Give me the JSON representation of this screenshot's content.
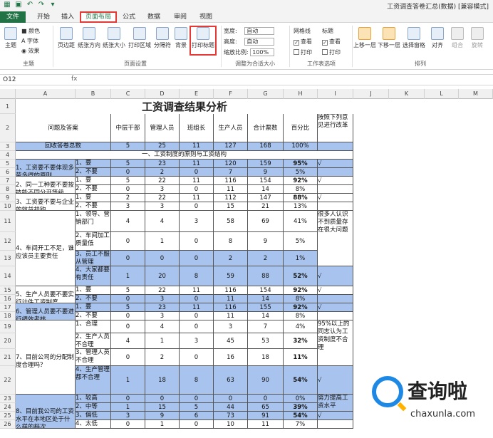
{
  "window": {
    "title": "工资调查答卷汇总(数据) [兼容模式]"
  },
  "tabs": [
    "文件",
    "开始",
    "插入",
    "页面布局",
    "公式",
    "数据",
    "审阅",
    "视图"
  ],
  "ribbon": {
    "theme": {
      "themes": "主题",
      "colors": "颜色",
      "fonts": "字体",
      "effects": "效果",
      "group": "主题"
    },
    "page_setup": {
      "margins": "页边距",
      "orientation": "纸张方向",
      "size": "纸张大小",
      "print_area": "打印区域",
      "breaks": "分隔符",
      "background": "背景",
      "print_titles": "打印标题",
      "group": "页面设置"
    },
    "scale": {
      "width_label": "宽度:",
      "width_value": "自动",
      "height_label": "高度:",
      "height_value": "自动",
      "scale_label": "缩放比例:",
      "scale_value": "100%",
      "group": "调整为合适大小"
    },
    "sheet_options": {
      "gridlines": "网格线",
      "headings": "标题",
      "view": "查看",
      "print": "打印",
      "group": "工作表选项"
    },
    "arrange": {
      "bring_forward": "上移一层",
      "send_backward": "下移一层",
      "selection_pane": "选择窗格",
      "align": "对齐",
      "group_btn": "组合",
      "rotate": "旋转",
      "group": "排列"
    }
  },
  "formula_bar": {
    "name_box": "O12",
    "fx": "fx"
  },
  "columns": [
    "A",
    "B",
    "C",
    "D",
    "E",
    "F",
    "G",
    "H",
    "I",
    "J",
    "K",
    "L",
    "M"
  ],
  "rows": [
    "1",
    "2",
    "3",
    "4",
    "5",
    "6",
    "7",
    "8",
    "9",
    "10",
    "11",
    "12",
    "13",
    "14",
    "15",
    "16",
    "17",
    "18",
    "19",
    "20",
    "21",
    "22",
    "23",
    "24",
    "25",
    "26"
  ],
  "sheet": {
    "title": "工资调查结果分析",
    "header": {
      "q": "问题及答案",
      "c": "中层干部",
      "d": "管理人员",
      "e": "班组长",
      "f": "生产人员",
      "g": "合计票数",
      "h": "百分比",
      "i": "按照下列意见进行改革"
    },
    "total": {
      "label": "回收答卷总数",
      "c": "5",
      "d": "25",
      "e": "11",
      "f": "127",
      "g": "168",
      "h": "100%"
    },
    "section1": "一、工资制度的原则与工资结构",
    "q1": "1、工资要不要体现多劳多得的原则",
    "q2": "2、同一工种要不要按技能不同分开等级",
    "q3": "3、工资要不要与企业的效益挂钩",
    "q4": "4、车间开工不足，谁应该员主要责任",
    "q5": "5、生产人员要不要实行计件工资制度",
    "q6": "6、管理人员要不要进行绩效考核",
    "q7": "7、目前公司的分配制度合理吗？",
    "q8": "8、目前我公司的工资水平在本地区处于什么样的档次",
    "r5": {
      "b": "1、要",
      "c": "5",
      "d": "23",
      "e": "11",
      "f": "120",
      "g": "159",
      "h": "95%",
      "i": "√"
    },
    "r6": {
      "b": "2、不要",
      "c": "0",
      "d": "2",
      "e": "0",
      "f": "7",
      "g": "9",
      "h": "5%"
    },
    "r7": {
      "b": "1、要",
      "c": "5",
      "d": "22",
      "e": "11",
      "f": "116",
      "g": "154",
      "h": "92%",
      "i": "√"
    },
    "r8": {
      "b": "2、不要",
      "c": "0",
      "d": "3",
      "e": "0",
      "f": "11",
      "g": "14",
      "h": "8%"
    },
    "r9": {
      "b": "1、要",
      "c": "2",
      "d": "22",
      "e": "11",
      "f": "112",
      "g": "147",
      "h": "88%",
      "i": "√"
    },
    "r10": {
      "b": "2、不要",
      "c": "3",
      "d": "3",
      "e": "0",
      "f": "15",
      "g": "21",
      "h": "13%"
    },
    "r11": {
      "b": "1、领导、营销部门",
      "c": "4",
      "d": "4",
      "e": "3",
      "f": "58",
      "g": "69",
      "h": "41%",
      "i": "很多人认识不到质量存在很大问题"
    },
    "r12": {
      "b": "2、车间加工质量低",
      "c": "0",
      "d": "1",
      "e": "0",
      "f": "8",
      "g": "9",
      "h": "5%"
    },
    "r13": {
      "b": "3、员工不服从管理",
      "c": "0",
      "d": "0",
      "e": "0",
      "f": "2",
      "g": "2",
      "h": "1%"
    },
    "r14": {
      "b": "4、大家都要有责任",
      "c": "1",
      "d": "20",
      "e": "8",
      "f": "59",
      "g": "88",
      "h": "52%",
      "i": "√"
    },
    "r15": {
      "b": "1、要",
      "c": "5",
      "d": "22",
      "e": "11",
      "f": "116",
      "g": "154",
      "h": "92%",
      "i": "√"
    },
    "r16": {
      "b": "2、不要",
      "c": "0",
      "d": "3",
      "e": "0",
      "f": "11",
      "g": "14",
      "h": "8%"
    },
    "r17": {
      "b": "1、要",
      "c": "5",
      "d": "23",
      "e": "11",
      "f": "116",
      "g": "155",
      "h": "92%",
      "i": "√"
    },
    "r18": {
      "b": "2、不要",
      "c": "0",
      "d": "3",
      "e": "0",
      "f": "11",
      "g": "14",
      "h": "8%"
    },
    "r19": {
      "b": "1、合理",
      "c": "0",
      "d": "4",
      "e": "0",
      "f": "3",
      "g": "7",
      "h": "4%",
      "i": "95%以上的同志认为工资制度不合理"
    },
    "r20": {
      "b": "2、生产人员不合理",
      "c": "4",
      "d": "1",
      "e": "3",
      "f": "45",
      "g": "53",
      "h": "32%"
    },
    "r21": {
      "b": "3、管理人员不合理",
      "c": "0",
      "d": "2",
      "e": "0",
      "f": "16",
      "g": "18",
      "h": "11%"
    },
    "r22": {
      "b": "4、生产管理都不合理",
      "c": "1",
      "d": "18",
      "e": "8",
      "f": "63",
      "g": "90",
      "h": "54%",
      "i": "√"
    },
    "r23": {
      "b": "1、较高",
      "c": "0",
      "d": "0",
      "e": "0",
      "f": "0",
      "g": "0",
      "h": "0%",
      "i": "努力提高工资水平"
    },
    "r24": {
      "b": "2、中等",
      "c": "1",
      "d": "15",
      "e": "5",
      "f": "44",
      "g": "65",
      "h": "39%"
    },
    "r25": {
      "b": "3、偏低",
      "c": "3",
      "d": "9",
      "e": "6",
      "f": "73",
      "g": "91",
      "h": "54%",
      "i": "√"
    },
    "r26": {
      "b": "4、太低",
      "c": "0",
      "d": "1",
      "e": "0",
      "f": "10",
      "g": "11",
      "h": "7%"
    }
  },
  "watermark": {
    "brand": "查询啦",
    "url": "chaxunla.com"
  }
}
